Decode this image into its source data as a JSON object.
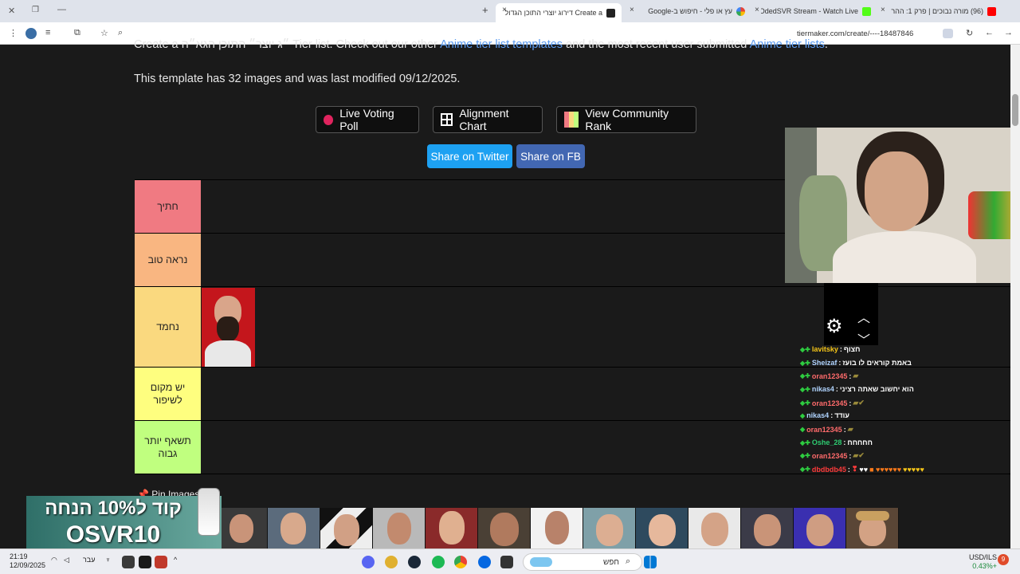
{
  "browser": {
    "tabs": [
      {
        "title": "(96) מורה נבוכים | פרק 1: ההר"
      },
      {
        "title": "OdedSVR Stream - Watch Live"
      },
      {
        "title": "עץ או פלי - חיפוש ב-Google"
      },
      {
        "title": "Create a דירוג יוצרי התוכן הגדול"
      }
    ],
    "url": "tiermaker.com/create/----18487846",
    "new_tab": "+",
    "close": "×"
  },
  "page": {
    "desc_top": "Create a ״ג יוצר״ התוכן הגא״ה Tier list. Check out our other",
    "desc_link1": "Anime tier list templates",
    "desc_mid": "and the most recent user submitted",
    "desc_link2": "Anime tier lists",
    "desc_end": ".",
    "template_info": "This template has 32 images and was last modified 09/12/2025.",
    "buttons": {
      "live_poll": "Live Voting Poll",
      "alignment": "Alignment Chart",
      "community": "View Community Rank",
      "twitter": "Share on Twitter",
      "fb": "Share on FB"
    },
    "tiers": [
      {
        "label": "חתיך",
        "color": "#f07a82"
      },
      {
        "label": "נראה טוב",
        "color": "#f9b681"
      },
      {
        "label": "נחמד",
        "color": "#fad97f"
      },
      {
        "label": "יש מקום לשיפור",
        "color": "#fefe7f"
      },
      {
        "label": "תשאף יותר גבוה",
        "color": "#c0ff7f"
      }
    ],
    "pin_images": "Pin Images"
  },
  "chat": [
    {
      "user": "lavitsky",
      "color": "#f5c518",
      "msg": "חצוף"
    },
    {
      "user": "Sheizaf",
      "color": "#b0d4ff",
      "msg": "באמת קוראים לו בועז"
    },
    {
      "user": "oran12345",
      "color": "#ff6b6b",
      "msg": ""
    },
    {
      "user": "nikas4",
      "color": "#b0d4ff",
      "msg": "הוא יחשוב שאתה רציני"
    },
    {
      "user": "oran12345",
      "color": "#ff6b6b",
      "msg": ""
    },
    {
      "user": "nikas4",
      "color": "#b0d4ff",
      "msg": "עודד"
    },
    {
      "user": "oran12345",
      "color": "#ff6b6b",
      "msg": ""
    },
    {
      "user": "Oshe_28",
      "color": "#2ecc71",
      "msg": "חחחחח"
    },
    {
      "user": "oran12345",
      "color": "#ff6b6b",
      "msg": ""
    },
    {
      "user": "dbdbdb45",
      "color": "#ff3b3b",
      "msg": "♥♥"
    }
  ],
  "banner": {
    "line1": "קוד ל10% הנחה",
    "line2": "OSVR10"
  },
  "taskbar": {
    "time": "21:19",
    "date": "12/09/2025",
    "lang": "עבר",
    "search_placeholder": "חפש",
    "currency": "USD/ILS",
    "currency_change": "0.43%+",
    "notif_count": "9"
  }
}
